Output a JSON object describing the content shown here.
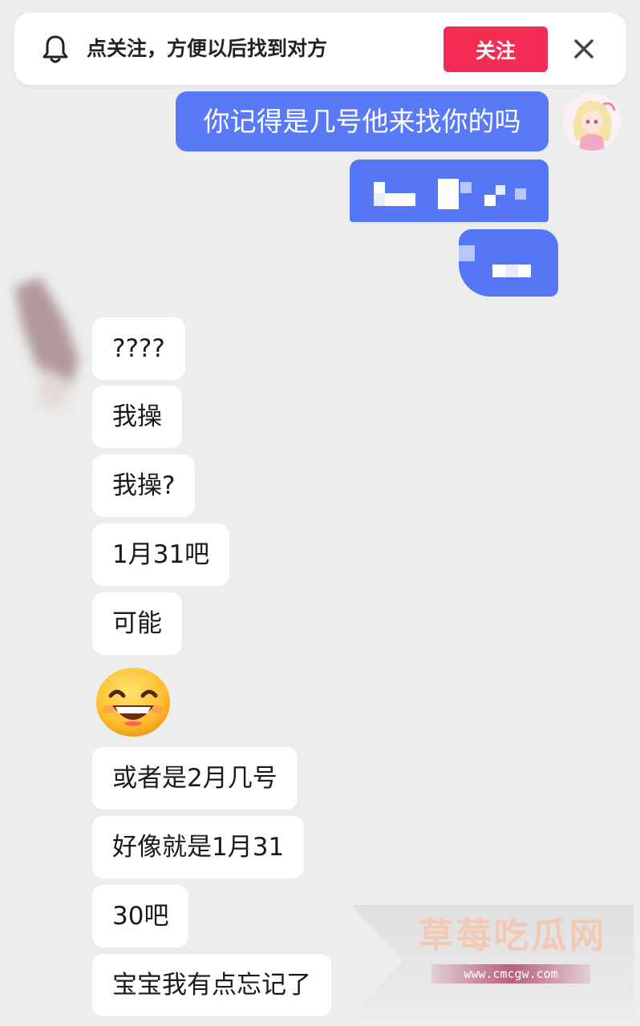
{
  "banner": {
    "icon": "bell-icon",
    "text": "点关注，方便以后找到对方",
    "follow_label": "关注",
    "close_icon": "close-icon",
    "accent": "#f42d55"
  },
  "outgoing": {
    "color": "#5a79f6",
    "messages": [
      "你记得是几号他来找你的吗"
    ]
  },
  "incoming": {
    "messages": [
      "????",
      "我操",
      "我操?",
      "1月31吧",
      "可能",
      "或者是2月几号",
      "好像就是1月31",
      "30吧",
      "宝宝我有点忘记了"
    ],
    "emoji": "grinning-face-emoji"
  },
  "watermark": {
    "title": "草莓吃瓜网",
    "url": "www.cmcgw.com"
  }
}
